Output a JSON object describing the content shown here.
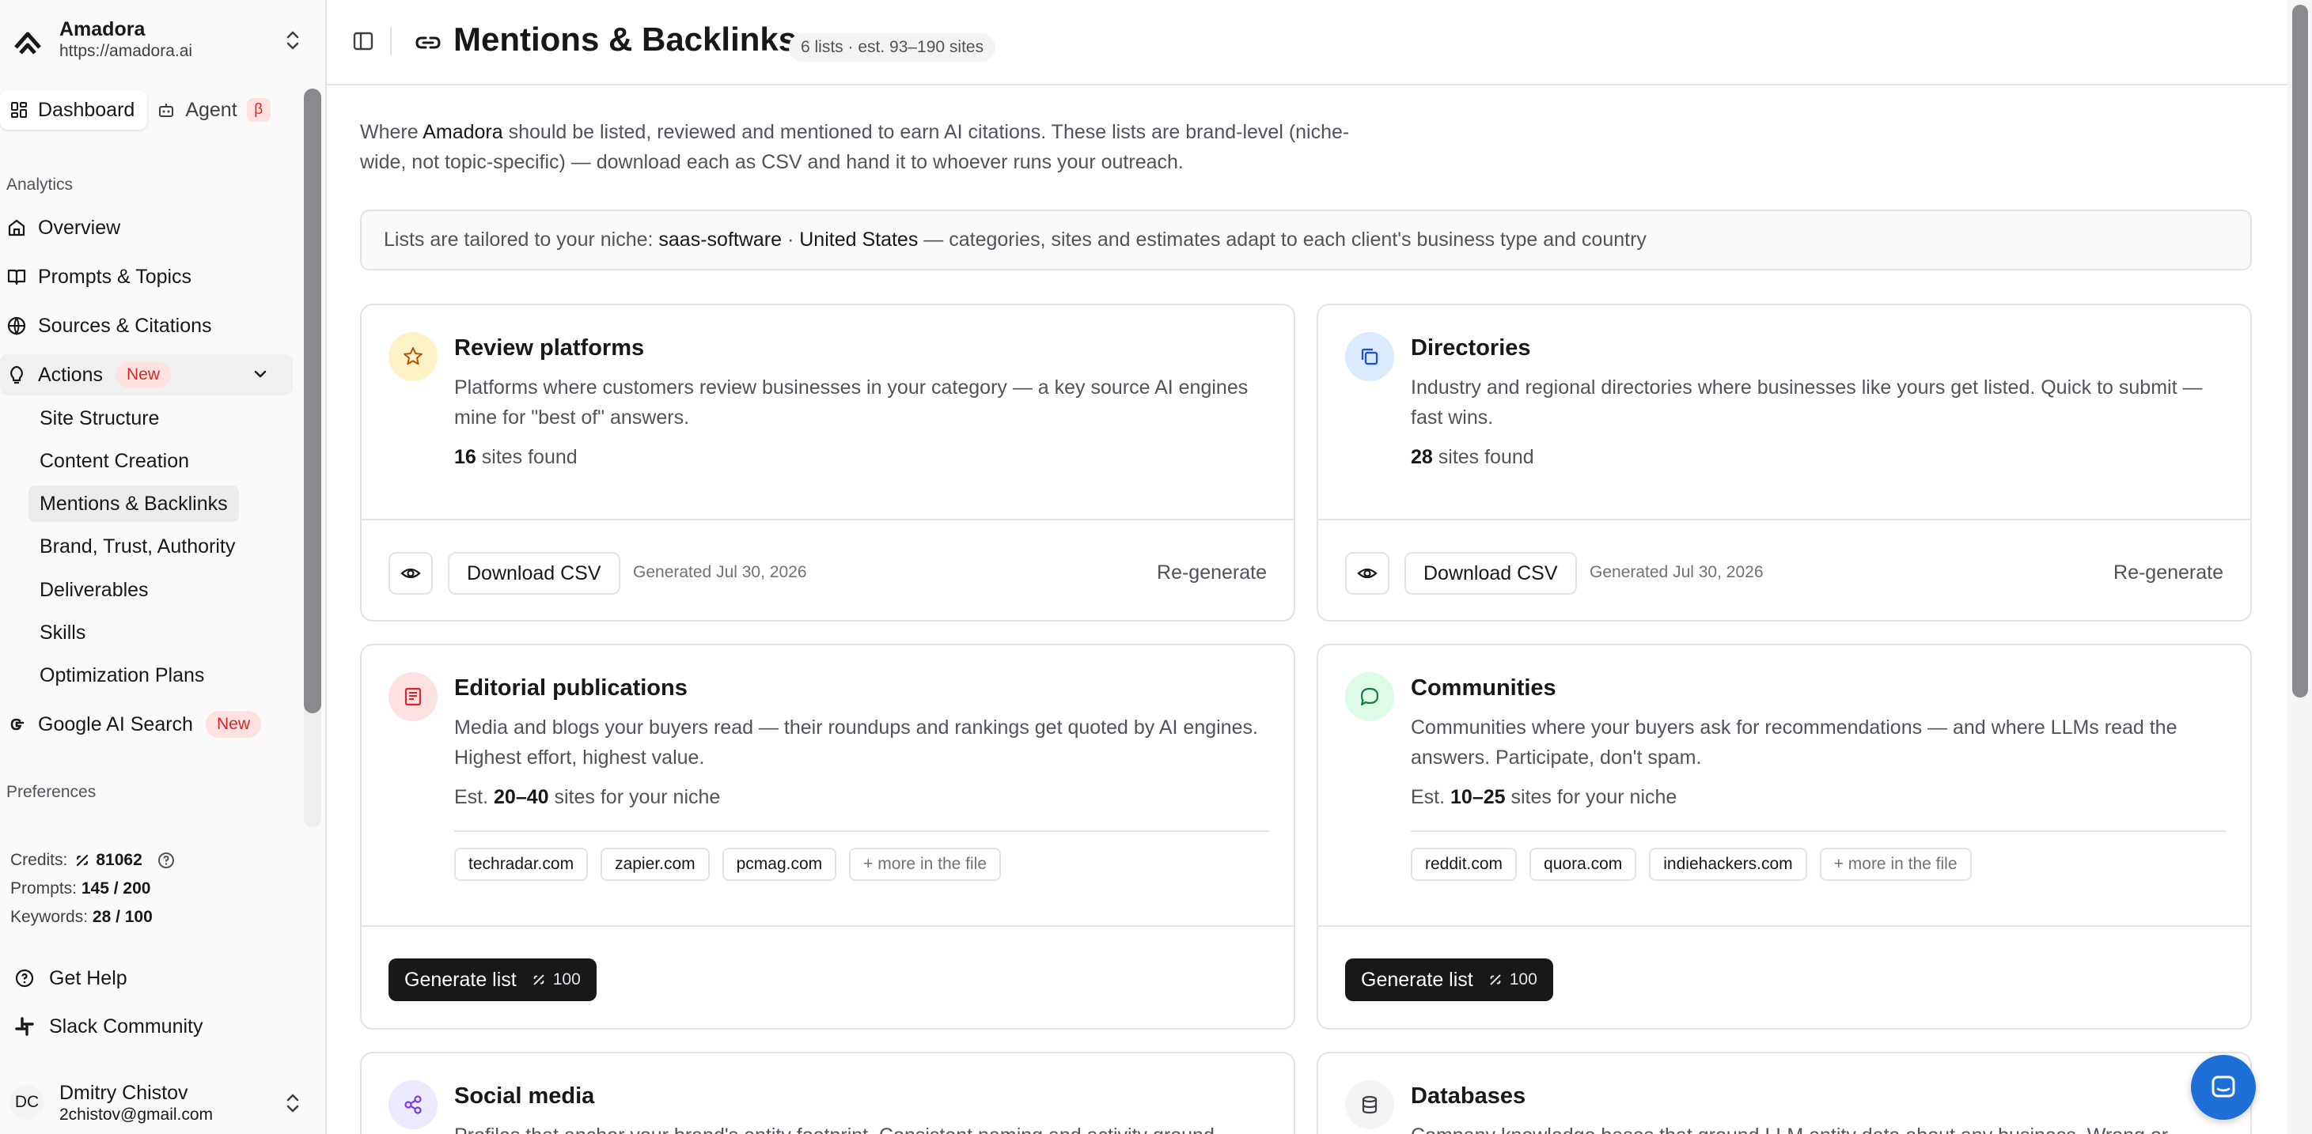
{
  "workspace": {
    "name": "Amadora",
    "url": "https://amadora.ai"
  },
  "mode_tabs": {
    "dashboard": "Dashboard",
    "agent": "Agent",
    "beta": "β"
  },
  "nav": {
    "analytics_heading": "Analytics",
    "overview": "Overview",
    "prompts_topics": "Prompts & Topics",
    "sources_citations": "Sources & Citations",
    "actions": "Actions",
    "actions_badge": "New",
    "actions_sub": [
      "Site Structure",
      "Content Creation",
      "Mentions & Backlinks",
      "Brand, Trust, Authority",
      "Deliverables",
      "Skills",
      "Optimization Plans"
    ],
    "google_ai_search": "Google AI Search",
    "google_ai_badge": "New",
    "preferences_heading": "Preferences"
  },
  "credits": {
    "credits_label": "Credits:",
    "credits_value": "81062",
    "prompts_label": "Prompts:",
    "prompts_value": "145 / 200",
    "keywords_label": "Keywords:",
    "keywords_value": "28 / 100"
  },
  "footer_links": {
    "help": "Get Help",
    "slack": "Slack Community"
  },
  "user": {
    "initials": "DC",
    "name": "Dmitry Chistov",
    "email": "2chistov@gmail.com"
  },
  "page": {
    "title": "Mentions & Backlinks",
    "badge": "6 lists · est. 93–190 sites",
    "intro_pre": "Where ",
    "intro_brand": "Amadora",
    "intro_post": " should be listed, reviewed and mentioned to earn AI citations. These lists are brand-level (niche-wide, not topic-specific) — download each as CSV and hand it to whoever runs your outreach.",
    "niche_pre": "Lists are tailored to your niche: ",
    "niche_value": "saas-software",
    "niche_sep": " · ",
    "niche_country": "United States",
    "niche_post": " — categories, sites and estimates adapt to each client's business type and country"
  },
  "cards": {
    "review": {
      "title": "Review platforms",
      "desc": "Platforms where customers review businesses in your category — a key source AI engines mine for \"best of\" answers.",
      "count": "16",
      "count_suffix": " sites found",
      "download": "Download CSV",
      "generated": "Generated Jul 30, 2026",
      "regen": "Re-generate",
      "icon": "star-icon"
    },
    "directories": {
      "title": "Directories",
      "desc": "Industry and regional directories where businesses like yours get listed. Quick to submit — fast wins.",
      "count": "28",
      "count_suffix": " sites found",
      "download": "Download CSV",
      "generated": "Generated Jul 30, 2026",
      "regen": "Re-generate",
      "icon": "copy-icon"
    },
    "editorial": {
      "title": "Editorial publications",
      "desc": "Media and blogs your buyers read — their roundups and rankings get quoted by AI engines. Highest effort, highest value.",
      "est_prefix": "Est. ",
      "est": "20–40",
      "est_suffix": " sites for your niche",
      "chips": [
        "techradar.com",
        "zapier.com",
        "pcmag.com"
      ],
      "more": "+ more in the file",
      "generate": "Generate list",
      "cost": "100",
      "icon": "newspaper-icon"
    },
    "communities": {
      "title": "Communities",
      "desc": "Communities where your buyers ask for recommendations — and where LLMs read the answers. Participate, don't spam.",
      "est_prefix": "Est. ",
      "est": "10–25",
      "est_suffix": " sites for your niche",
      "chips": [
        "reddit.com",
        "quora.com",
        "indiehackers.com"
      ],
      "more": "+ more in the file",
      "generate": "Generate list",
      "cost": "100",
      "icon": "chat-bubble-icon"
    },
    "social": {
      "title": "Social media",
      "desc": "Profiles that anchor your brand's entity footprint. Consistent naming and activity ground",
      "icon": "share-icon"
    },
    "databases": {
      "title": "Databases",
      "desc": "Company knowledge bases that ground LLM entity data about any business. Wrong or",
      "icon": "database-icon"
    }
  },
  "colors": {
    "accent_dark": "#18181b",
    "badge_red": "#dc2626",
    "review_icon_bg": "#fef3c7",
    "directories_icon_bg": "#dbeafe",
    "editorial_icon_bg": "#fee2e2",
    "communities_icon_bg": "#dcfce7",
    "social_icon_bg": "#ede9fe",
    "databases_icon_bg": "#f4f4f5",
    "chat_fab": "#1f6fd8"
  }
}
